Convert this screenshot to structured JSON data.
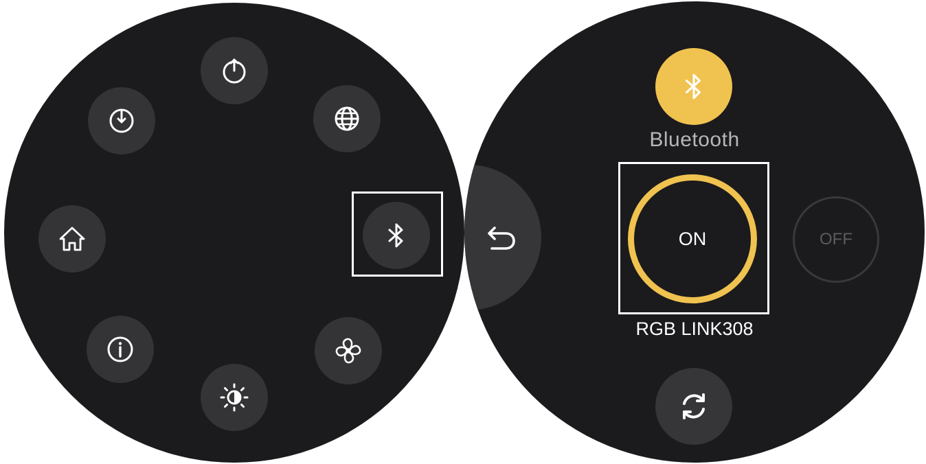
{
  "left_menu": {
    "items": [
      {
        "name": "shutdown",
        "icon": "power-up-icon"
      },
      {
        "name": "network",
        "icon": "globe-icon"
      },
      {
        "name": "bluetooth",
        "icon": "bluetooth-icon",
        "selected": true
      },
      {
        "name": "fan",
        "icon": "fan-icon"
      },
      {
        "name": "brightness",
        "icon": "brightness-icon"
      },
      {
        "name": "info",
        "icon": "info-icon"
      },
      {
        "name": "home",
        "icon": "home-icon"
      },
      {
        "name": "restart",
        "icon": "power-down-icon"
      }
    ]
  },
  "bluetooth_panel": {
    "title": "Bluetooth",
    "on_label": "ON",
    "off_label": "OFF",
    "device_name": "RGB LINK308",
    "selected_state": "ON"
  },
  "colors": {
    "accent": "#f0c24f",
    "background": "#1b1a1d",
    "button": "#343336",
    "highlight_border": "#ffffff"
  }
}
